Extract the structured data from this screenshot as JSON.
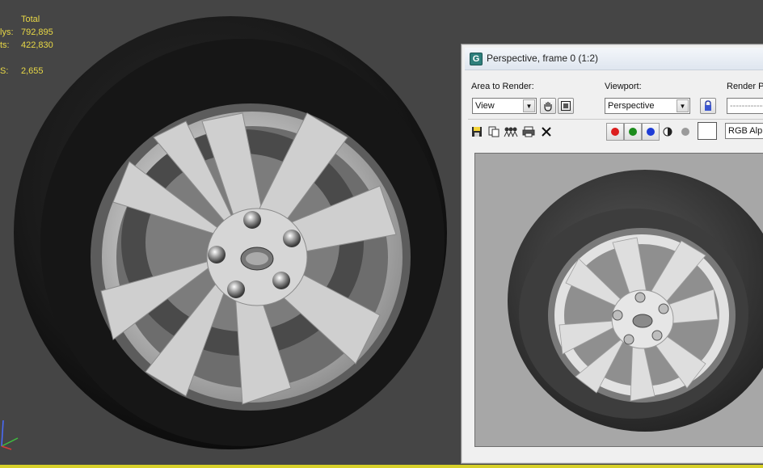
{
  "viewport": {
    "stats": {
      "header": "Total",
      "rows": [
        {
          "label": "lys:",
          "value": "792,895"
        },
        {
          "label": "ts:",
          "value": "422,830"
        },
        {
          "label": "S:",
          "value": "2,655"
        }
      ]
    },
    "colors": {
      "background": "#454545",
      "stats_text": "#e8d846",
      "timeline_bar": "#d7d02a"
    }
  },
  "render_window": {
    "title": "Perspective, frame 0 (1:2)",
    "area_to_render": {
      "label": "Area to Render:",
      "value": "View"
    },
    "viewport": {
      "label": "Viewport:",
      "value": "Perspective"
    },
    "render_preset": {
      "label": "Render P",
      "value": "------------"
    },
    "channel": {
      "value": "RGB Alp"
    },
    "icons": {
      "app": "3dsmax-icon",
      "region_edit": "hand-icon",
      "region_auto": "region-icon",
      "lock": "lock-icon",
      "save": "save-icon",
      "copy": "copy-icon",
      "clone": "clone-icon",
      "print": "print-icon",
      "clear": "clear-icon",
      "mono": "mono-icon",
      "alpha": "alpha-icon"
    },
    "channel_colors": {
      "red": "#dc1e1e",
      "green": "#1c8c1c",
      "blue": "#1e3cd6"
    }
  }
}
